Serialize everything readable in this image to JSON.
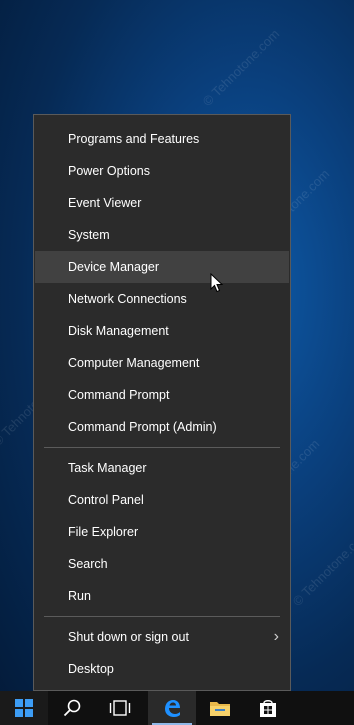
{
  "watermark": "© Tehnotone.com",
  "menu": {
    "group1": [
      {
        "label": "Programs and Features"
      },
      {
        "label": "Power Options"
      },
      {
        "label": "Event Viewer"
      },
      {
        "label": "System"
      },
      {
        "label": "Device Manager",
        "hovered": true
      },
      {
        "label": "Network Connections"
      },
      {
        "label": "Disk Management"
      },
      {
        "label": "Computer Management"
      },
      {
        "label": "Command Prompt"
      },
      {
        "label": "Command Prompt (Admin)"
      }
    ],
    "group2": [
      {
        "label": "Task Manager"
      },
      {
        "label": "Control Panel"
      },
      {
        "label": "File Explorer"
      },
      {
        "label": "Search"
      },
      {
        "label": "Run"
      }
    ],
    "group3": [
      {
        "label": "Shut down or sign out",
        "submenu": true
      },
      {
        "label": "Desktop"
      }
    ]
  },
  "taskbar": {
    "icons": [
      "windows-start-icon",
      "search-icon",
      "task-view-icon",
      "edge-icon",
      "file-explorer-icon",
      "store-icon"
    ],
    "colors": {
      "accent": "#1e90ff",
      "menu_bg": "#2b2b2b",
      "hover_bg": "#414141"
    }
  }
}
